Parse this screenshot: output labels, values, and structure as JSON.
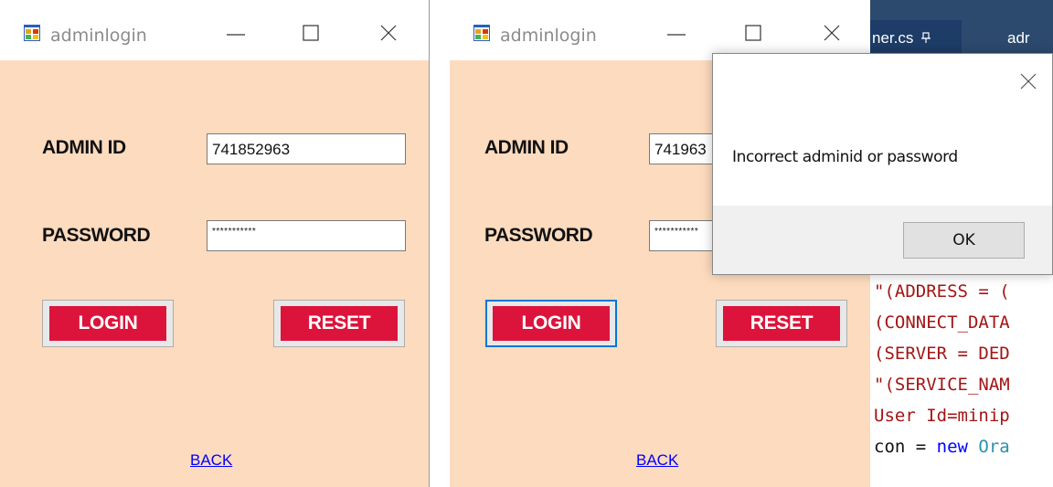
{
  "window1": {
    "title": "adminlogin",
    "admin_id_label": "ADMIN ID",
    "admin_id_value": "741852963",
    "password_label": "PASSWORD",
    "password_value": "***********",
    "login_label": "LOGIN",
    "reset_label": "RESET",
    "back_label": "BACK"
  },
  "window2": {
    "title": "adminlogin",
    "admin_id_label": "ADMIN ID",
    "admin_id_value": "741963",
    "password_label": "PASSWORD",
    "password_value": "***********",
    "login_label": "LOGIN",
    "reset_label": "RESET",
    "back_label": "BACK"
  },
  "editor": {
    "tab1": "ner.cs",
    "tab2": "adr",
    "lines": [
      {
        "text": "\"(ADDRESS = ("
      },
      {
        "text": "(CONNECT_DATA"
      },
      {
        "text": "(SERVER = DED"
      },
      {
        "text": "\"(SERVICE_NAM"
      },
      {
        "text": "User Id=minip"
      },
      {
        "kw": "con",
        "eq": " = ",
        "kw2": "new",
        "ty": " Ora"
      }
    ]
  },
  "msgbox": {
    "text": "Incorrect adminid or password",
    "ok_label": "OK"
  },
  "colors": {
    "form_bg": "#fddbbe",
    "button_red": "#dc143c",
    "focus_blue": "#0078d7",
    "link_blue": "#0000ff"
  }
}
